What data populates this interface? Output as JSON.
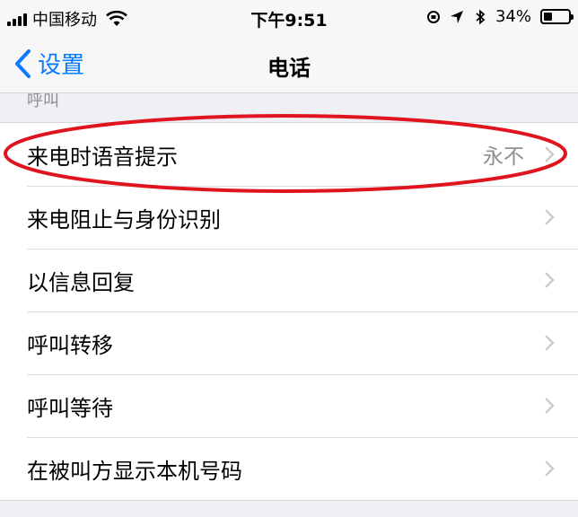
{
  "status_bar": {
    "carrier": "中国移动",
    "time": "下午9:51",
    "battery_percent": "34%",
    "battery_level": 0.34
  },
  "nav": {
    "back_label": "设置",
    "title": "电话"
  },
  "section": {
    "header": "呼叫"
  },
  "rows": [
    {
      "label": "来电时语音提示",
      "value": "永不"
    },
    {
      "label": "来电阻止与身份识别",
      "value": ""
    },
    {
      "label": "以信息回复",
      "value": ""
    },
    {
      "label": "呼叫转移",
      "value": ""
    },
    {
      "label": "呼叫等待",
      "value": ""
    },
    {
      "label": "在被叫方显示本机号码",
      "value": ""
    }
  ],
  "colors": {
    "accent": "#0a7aff",
    "annotation": "#e0141e",
    "secondary_text": "#8e8e93"
  }
}
